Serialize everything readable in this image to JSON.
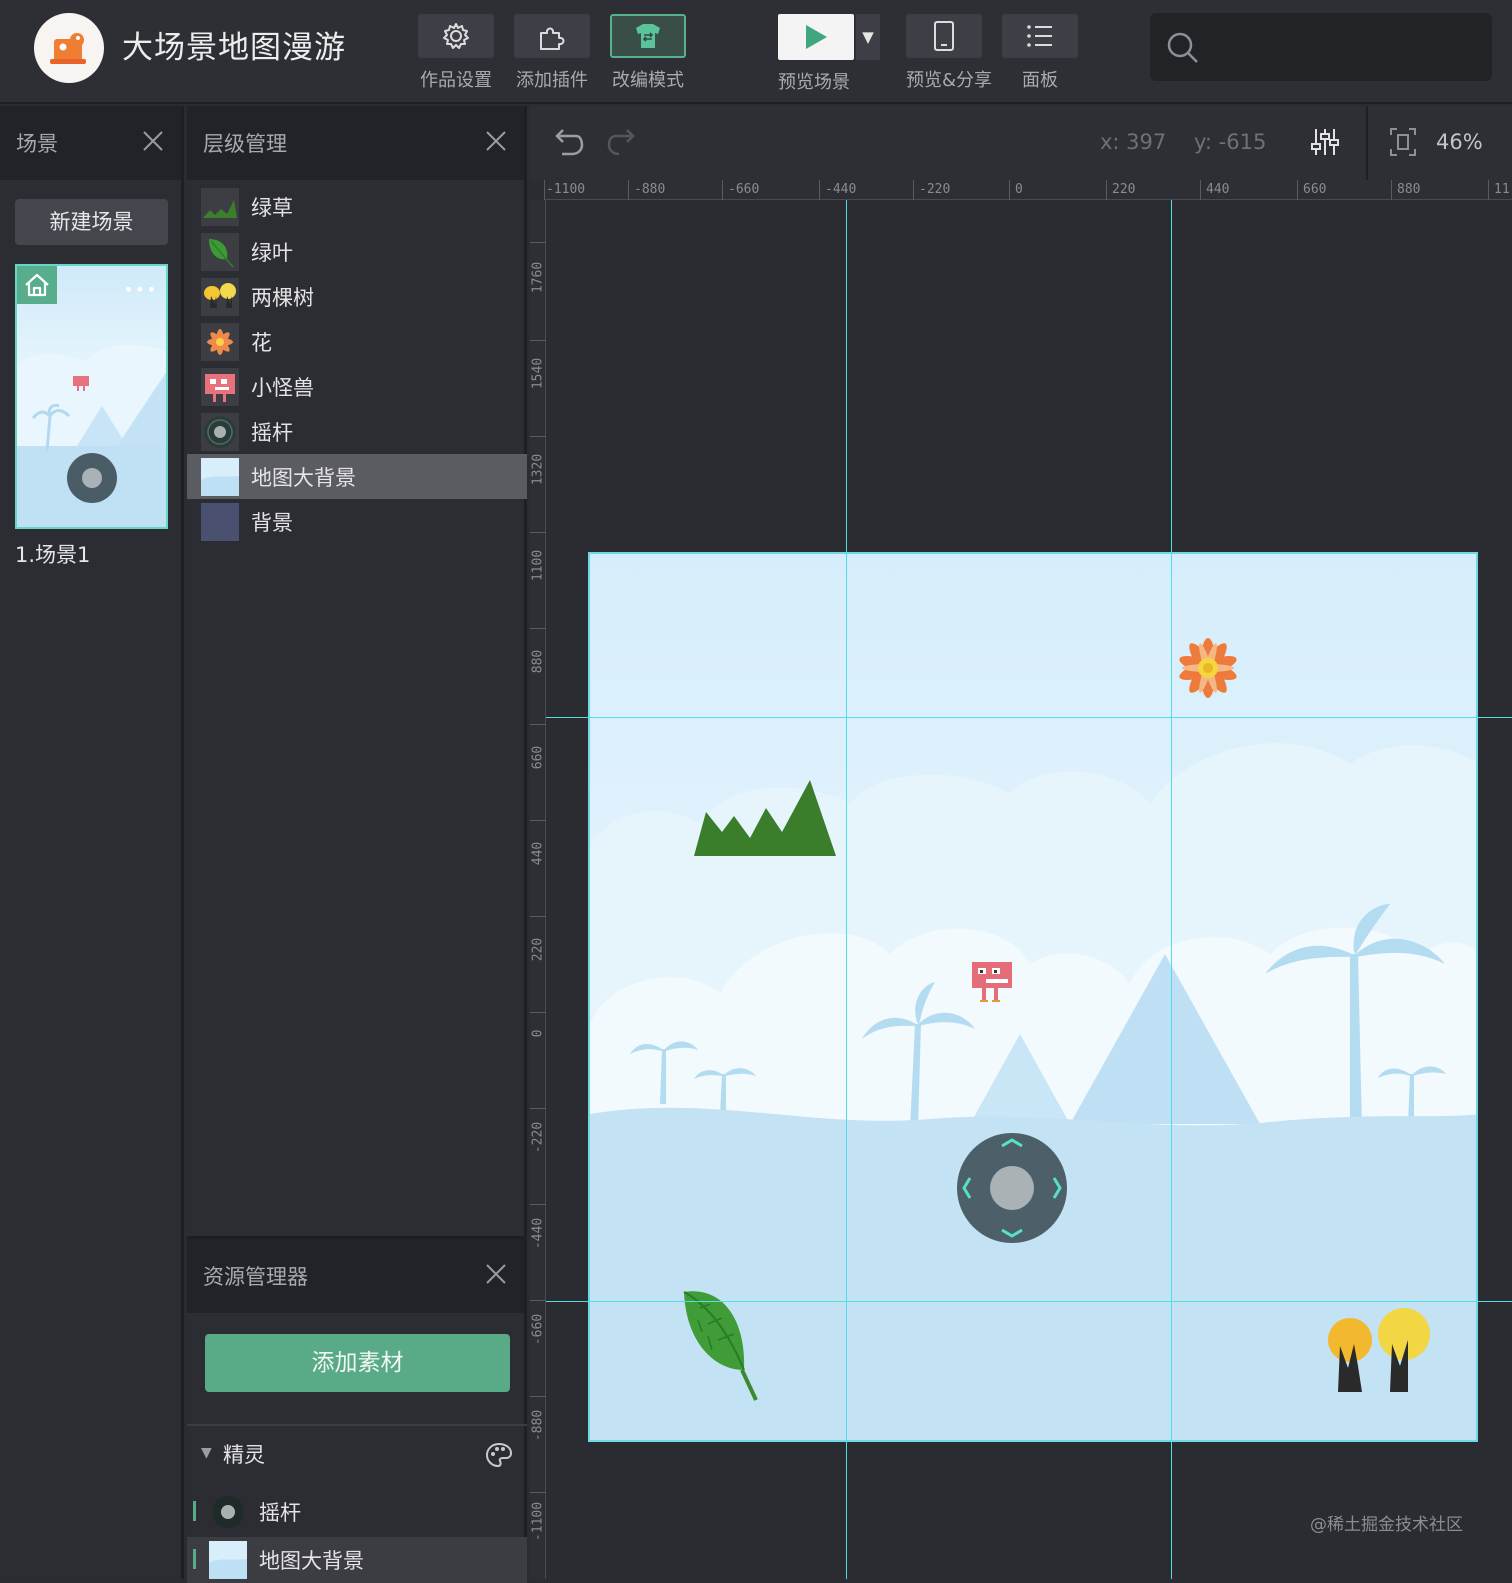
{
  "app": {
    "title": "大场景地图漫游"
  },
  "toolbar": {
    "items": [
      {
        "label": "作品设置",
        "icon": "gear-icon"
      },
      {
        "label": "添加插件",
        "icon": "puzzle-icon"
      },
      {
        "label": "改编模式",
        "icon": "shirt-icon",
        "active": true
      },
      {
        "label": "预览场景",
        "icon": "play-icon"
      },
      {
        "label": "预览&分享",
        "icon": "phone-icon"
      },
      {
        "label": "面板",
        "icon": "list-icon"
      }
    ],
    "search_placeholder": ""
  },
  "scene_panel": {
    "title": "场景",
    "new_scene_label": "新建场景",
    "scenes": [
      {
        "name": "1.场景1"
      }
    ]
  },
  "layers_panel": {
    "title": "层级管理",
    "layers": [
      {
        "name": "绿草",
        "icon": "grass-icon"
      },
      {
        "name": "绿叶",
        "icon": "leaf-icon"
      },
      {
        "name": "两棵树",
        "icon": "trees-icon"
      },
      {
        "name": "花",
        "icon": "flower-icon"
      },
      {
        "name": "小怪兽",
        "icon": "monster-icon"
      },
      {
        "name": "摇杆",
        "icon": "joystick-icon"
      },
      {
        "name": "地图大背景",
        "icon": "map-bg-icon",
        "selected": true
      },
      {
        "name": "背景",
        "icon": "bg-icon"
      }
    ]
  },
  "assets_panel": {
    "title": "资源管理器",
    "add_label": "添加素材",
    "group": {
      "name": "精灵"
    },
    "items": [
      {
        "name": "摇杆",
        "icon": "joystick-icon"
      },
      {
        "name": "地图大背景",
        "icon": "map-bg-icon"
      }
    ]
  },
  "canvas": {
    "x_label": "x: 397",
    "y_label": "y: -615",
    "zoom": "46%",
    "ruler_x": [
      "-1100",
      "-880",
      "-660",
      "-440",
      "-220",
      "0",
      "220",
      "440",
      "660",
      "880",
      "11"
    ],
    "ruler_y": [
      "1760",
      "1540",
      "1320",
      "1100",
      "880",
      "660",
      "440",
      "220",
      "0",
      "-220",
      "-440",
      "-660",
      "-880",
      "-1100"
    ]
  },
  "watermark": "@稀土掘金技术社区",
  "colors": {
    "accent": "#59aa87",
    "guide": "#4fe0e6",
    "panel": "#2c2d33",
    "sky": "#d6eefb"
  }
}
